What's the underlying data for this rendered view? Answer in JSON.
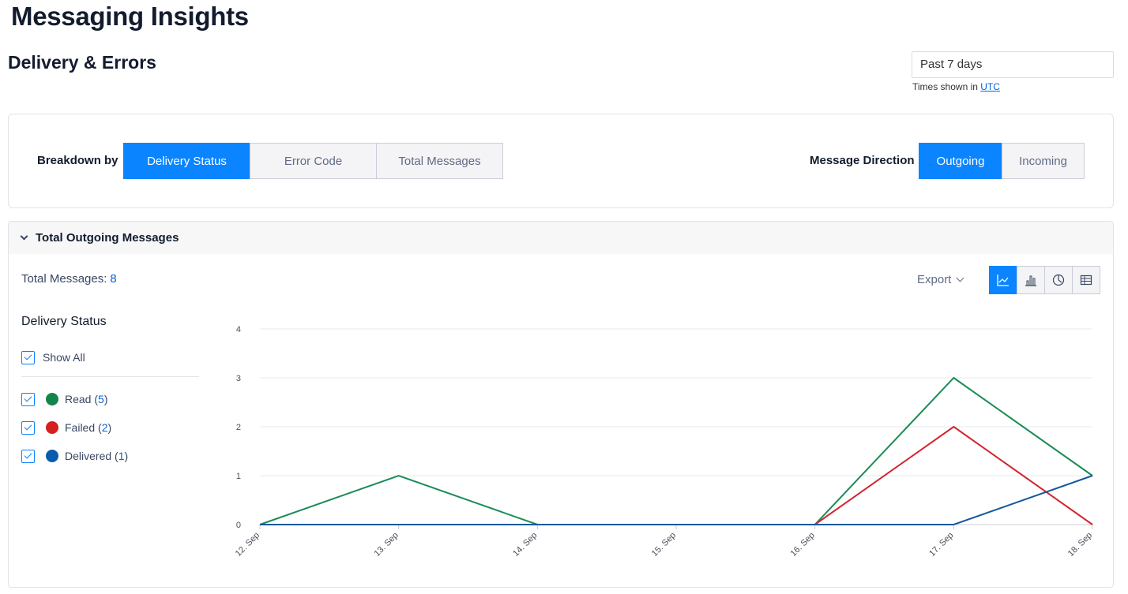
{
  "page_title": "Messaging Insights",
  "section_title": "Delivery & Errors",
  "date_range": {
    "value": "Past 7 days"
  },
  "timezone_note": {
    "prefix": "Times shown in ",
    "link": "UTC"
  },
  "breakdown": {
    "label": "Breakdown by",
    "options": [
      "Delivery Status",
      "Error Code",
      "Total Messages"
    ],
    "selected": "Delivery Status"
  },
  "direction": {
    "label": "Message Direction",
    "options": [
      "Outgoing",
      "Incoming"
    ],
    "selected": "Outgoing"
  },
  "accent_color": "#0a84ff",
  "panel": {
    "title": "Total Outgoing Messages",
    "total_label": "Total Messages:",
    "total_value": "8",
    "export_label": "Export",
    "view_icons": [
      "line-chart-icon",
      "bar-chart-icon",
      "pie-chart-icon",
      "table-icon"
    ],
    "active_view": "line-chart-icon"
  },
  "legend": {
    "title": "Delivery Status",
    "show_all": "Show All",
    "items": [
      {
        "label": "Read",
        "count": "(5)",
        "count_num": "5",
        "color": "#14854a"
      },
      {
        "label": "Failed",
        "count": "(2)",
        "count_num": "2",
        "color": "#d61f1f"
      },
      {
        "label": "Delivered",
        "count": "(1)",
        "count_num": "1",
        "color": "#0b5cad"
      }
    ]
  },
  "chart_data": {
    "type": "line",
    "x": [
      "12. Sep",
      "13. Sep",
      "14. Sep",
      "15. Sep",
      "16. Sep",
      "17. Sep",
      "18. Sep"
    ],
    "ylim": [
      0,
      4
    ],
    "yticks": [
      0,
      1,
      2,
      3,
      4
    ],
    "grid": true,
    "series": [
      {
        "name": "Read",
        "color": "#1a8c55",
        "values": [
          0,
          1,
          0,
          0,
          0,
          3,
          1
        ]
      },
      {
        "name": "Failed",
        "color": "#d1242f",
        "values": [
          0,
          0,
          0,
          0,
          0,
          2,
          0
        ]
      },
      {
        "name": "Delivered",
        "color": "#15599e",
        "values": [
          0,
          0,
          0,
          0,
          0,
          0,
          1
        ]
      }
    ]
  }
}
